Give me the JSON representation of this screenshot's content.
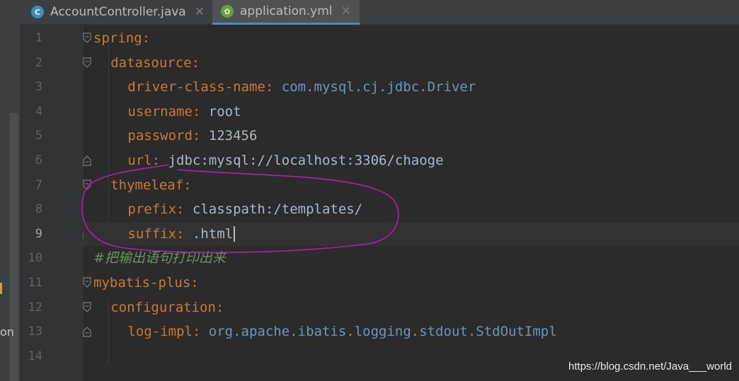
{
  "tabs": [
    {
      "label": "AccountController.java",
      "icon": "java-class-icon",
      "icon_glyph": "C"
    },
    {
      "label": "application.yml",
      "icon": "spring-yaml-icon",
      "icon_glyph": "✿"
    }
  ],
  "sidebar": {
    "partial_text": "on"
  },
  "editor": {
    "current_line": 9,
    "lines": [
      {
        "num": "1",
        "key": "spring",
        "colon": ":",
        "value": ""
      },
      {
        "num": "2",
        "key": "datasource",
        "colon": ":",
        "value": ""
      },
      {
        "num": "3",
        "key": "driver-class-name",
        "colon": ":",
        "value": " com.mysql.cj.jdbc.Driver"
      },
      {
        "num": "4",
        "key": "username",
        "colon": ":",
        "value": " root"
      },
      {
        "num": "5",
        "key": "password",
        "colon": ":",
        "value": " 123456"
      },
      {
        "num": "6",
        "key": "url",
        "colon": ":",
        "value": " jdbc:mysql://localhost:3306/chaoge"
      },
      {
        "num": "7",
        "key": "thymeleaf",
        "colon": ":",
        "value": ""
      },
      {
        "num": "8",
        "key": "prefix",
        "colon": ":",
        "value": " classpath:/templates/"
      },
      {
        "num": "9",
        "key": "suffix",
        "colon": ":",
        "value": " .html"
      },
      {
        "num": "10",
        "comment": "#把输出语句打印出来"
      },
      {
        "num": "11",
        "key": "mybatis-plus",
        "colon": ":",
        "value": ""
      },
      {
        "num": "12",
        "key": "configuration",
        "colon": ":",
        "value": ""
      },
      {
        "num": "13",
        "key": "log-impl",
        "colon": ":",
        "value": " org.apache.ibatis.logging.stdout.StdOutImpl"
      },
      {
        "num": "14"
      }
    ]
  },
  "colors": {
    "key": "#cc7832",
    "value": "#a9b7c6",
    "class_value": "#6897bb",
    "comment": "#629755",
    "annotation": "#b31bb3"
  },
  "watermark": "https://blog.csdn.net/Java___world"
}
